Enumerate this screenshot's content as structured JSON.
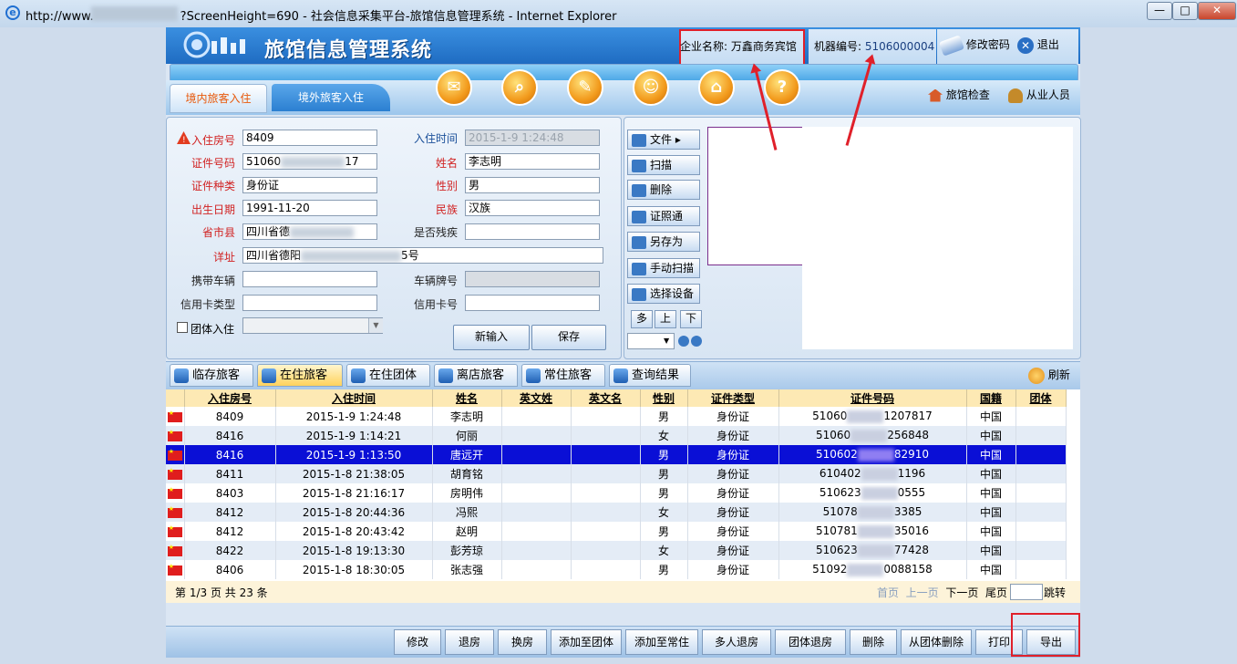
{
  "window": {
    "title_prefix": "http://www.",
    "title_suffix": "?ScreenHeight=690 - 社会信息采集平台-旅馆信息管理系统 - Internet Explorer",
    "min": "—",
    "max": "□",
    "close": "✕"
  },
  "header": {
    "app_title": "旅馆信息管理系统",
    "company_label": "企业名称:",
    "company_value": "万鑫商务宾馆",
    "machine_label": "机器编号:",
    "machine_value": "5106000004",
    "change_password": "修改密码",
    "logout": "退出"
  },
  "nav": {
    "tab_inbound": "境内旅客入住",
    "tab_foreign": "境外旅客入住",
    "hotel_check": "旅馆检查",
    "staff": "从业人员",
    "icons": [
      "mail-icon",
      "search-icon",
      "clean-icon",
      "person-icon",
      "home-gear-icon",
      "help-icon"
    ]
  },
  "form": {
    "room_no_label": "入住房号",
    "room_no": "8409",
    "checkin_time_label": "入住时间",
    "checkin_time": "2015-1-9 1:24:48",
    "id_no_label": "证件号码",
    "id_no_start": "51060",
    "id_no_end": "17",
    "name_label": "姓名",
    "name": "李志明",
    "id_type_label": "证件种类",
    "id_type": "身份证",
    "gender_label": "性别",
    "gender": "男",
    "birth_label": "出生日期",
    "birth": "1991-11-20",
    "ethnicity_label": "民族",
    "ethnicity": "汉族",
    "region_label": "省市县",
    "region": "四川省德",
    "disabled_label": "是否残疾",
    "disabled": "",
    "address_label": "详址",
    "address_start": "四川省德阳",
    "address_end": "5号",
    "vehicle_label": "携带车辆",
    "vehicle": "",
    "plate_label": "车辆牌号",
    "plate": "",
    "card_type_label": "信用卡类型",
    "card_type": "",
    "card_no_label": "信用卡号",
    "card_no": "",
    "group_checkin_label": "团体入住",
    "new_entry": "新输入",
    "save": "保存"
  },
  "side_toolbar": {
    "file": "文件 ▸",
    "scan": "扫描",
    "delete": "删除",
    "id_photo": "证照通",
    "save_as": "另存为",
    "manual_scan": "手动扫描",
    "select_device": "选择设备",
    "multi": "多",
    "up": "上",
    "down": "下"
  },
  "list_tabs": [
    {
      "label": "临存旅客",
      "active": false
    },
    {
      "label": "在住旅客",
      "active": true
    },
    {
      "label": "在住团体",
      "active": false
    },
    {
      "label": "离店旅客",
      "active": false
    },
    {
      "label": "常住旅客",
      "active": false
    },
    {
      "label": "查询结果",
      "active": false
    }
  ],
  "refresh": "刷新",
  "table": {
    "headers": [
      "",
      "入住房号",
      "入住时间",
      "姓名",
      "英文姓",
      "英文名",
      "性别",
      "证件类型",
      "证件号码",
      "国籍",
      "团体"
    ],
    "rows": [
      {
        "room": "8409",
        "time": "2015-1-9 1:24:48",
        "name": "李志明",
        "gender": "男",
        "id_type": "身份证",
        "id_start": "51060",
        "id_end": "1207817",
        "nation": "中国"
      },
      {
        "room": "8416",
        "time": "2015-1-9 1:14:21",
        "name": "何丽",
        "gender": "女",
        "id_type": "身份证",
        "id_start": "51060",
        "id_end": "256848",
        "nation": "中国"
      },
      {
        "room": "8416",
        "time": "2015-1-9 1:13:50",
        "name": "唐远开",
        "gender": "男",
        "id_type": "身份证",
        "id_start": "510602",
        "id_end": "82910",
        "nation": "中国"
      },
      {
        "room": "8411",
        "time": "2015-1-8 21:38:05",
        "name": "胡育铭",
        "gender": "男",
        "id_type": "身份证",
        "id_start": "610402",
        "id_end": "1196",
        "nation": "中国"
      },
      {
        "room": "8403",
        "time": "2015-1-8 21:16:17",
        "name": "房明伟",
        "gender": "男",
        "id_type": "身份证",
        "id_start": "510623",
        "id_end": "0555",
        "nation": "中国"
      },
      {
        "room": "8412",
        "time": "2015-1-8 20:44:36",
        "name": "冯熙",
        "gender": "女",
        "id_type": "身份证",
        "id_start": "51078",
        "id_end": "3385",
        "nation": "中国"
      },
      {
        "room": "8412",
        "time": "2015-1-8 20:43:42",
        "name": "赵明",
        "gender": "男",
        "id_type": "身份证",
        "id_start": "510781",
        "id_end": "35016",
        "nation": "中国"
      },
      {
        "room": "8422",
        "time": "2015-1-8 19:13:30",
        "name": "彭芳琼",
        "gender": "女",
        "id_type": "身份证",
        "id_start": "510623",
        "id_end": "77428",
        "nation": "中国"
      },
      {
        "room": "8406",
        "time": "2015-1-8 18:30:05",
        "name": "张志强",
        "gender": "男",
        "id_type": "身份证",
        "id_start": "51092",
        "id_end": "0088158",
        "nation": "中国"
      }
    ],
    "selected_index": 2
  },
  "pager": {
    "summary": "第 1/3 页   共 23 条",
    "first": "首页",
    "prev": "上一页",
    "next": "下一页",
    "last": "尾页",
    "jump": "跳转"
  },
  "bottom_toolbar": [
    "修改",
    "退房",
    "换房",
    "添加至团体",
    "添加至常住",
    "多人退房",
    "团体退房",
    "删除",
    "从团体删除",
    "打印",
    "导出"
  ],
  "colors": {
    "accent": "#1f6cc2",
    "highlight_box": "#e0202a",
    "selected_row": "#0a0fd6",
    "label_red": "#d12323"
  }
}
